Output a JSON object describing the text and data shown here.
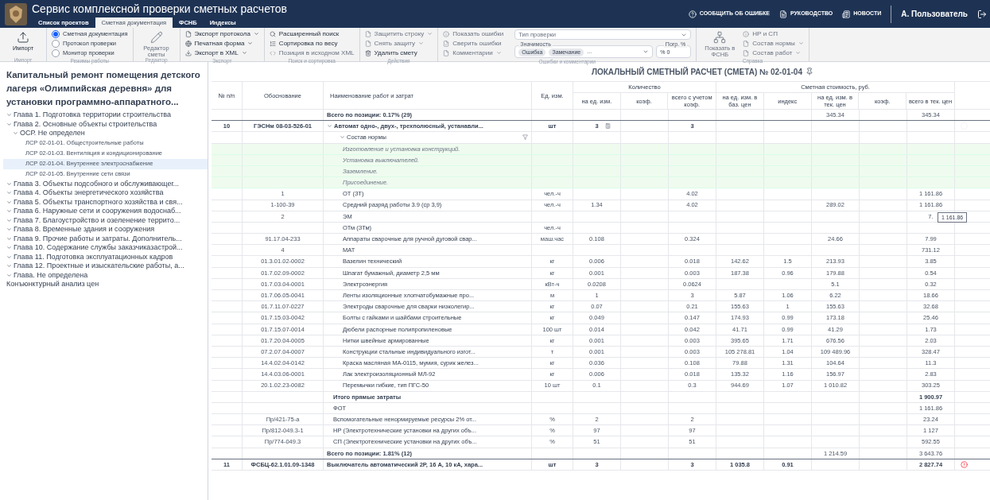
{
  "header": {
    "title": "Сервис комплексной проверки сметных расчетов",
    "tabs": [
      {
        "label": "Список проектов",
        "selected": false
      },
      {
        "label": "Сметная документация",
        "selected": true
      },
      {
        "label": "ФСНБ",
        "selected": false
      },
      {
        "label": "Индексы",
        "selected": false
      }
    ],
    "links": [
      {
        "kind": "help",
        "label": "СООБЩИТЬ ОБ ОШИБКЕ"
      },
      {
        "kind": "doc",
        "label": "РУКОВОДСТВО"
      },
      {
        "kind": "news",
        "label": "НОВОСТИ"
      }
    ],
    "user": "А. Пользователь"
  },
  "ribbon": [
    {
      "label": "Импорт",
      "items": [
        {
          "kind": "large",
          "label": "Импорт",
          "disabled": false
        }
      ]
    },
    {
      "label": "Режимы работы",
      "items": [
        {
          "kind": "radio",
          "label": "Сметная документация",
          "selected": true
        },
        {
          "kind": "radio",
          "label": "Протокол проверки",
          "selected": false
        },
        {
          "kind": "radio",
          "label": "Монитор проверки",
          "selected": false
        }
      ]
    },
    {
      "label": "Редактор",
      "items": [
        {
          "kind": "large",
          "label": "Редактор сметы",
          "disabled": true
        }
      ]
    },
    {
      "label": "Экспорт",
      "items": [
        {
          "kind": "small",
          "label": "Экспорт протокола",
          "dropdown": true,
          "disabled": false
        },
        {
          "kind": "small",
          "label": "Печатная форма",
          "dropdown": true,
          "disabled": false
        },
        {
          "kind": "small",
          "label": "Экспорт в XML",
          "dropdown": true,
          "disabled": false
        }
      ]
    },
    {
      "label": "Поиск и сортировка",
      "items": [
        {
          "kind": "small",
          "label": "Расширенный поиск",
          "dropdown": false,
          "disabled": false
        },
        {
          "kind": "small",
          "label": "Сортировка по весу",
          "dropdown": false,
          "disabled": false
        },
        {
          "kind": "small",
          "label": "Позиция в исходном XML",
          "dropdown": false,
          "disabled": true
        }
      ]
    },
    {
      "label": "Действия",
      "items": [
        {
          "kind": "small",
          "label": "Защитить строку",
          "dropdown": true,
          "disabled": true
        },
        {
          "kind": "small",
          "label": "Снять защиту",
          "dropdown": true,
          "disabled": true
        },
        {
          "kind": "small",
          "label": "Удалить смету",
          "dropdown": false,
          "disabled": false
        }
      ]
    },
    {
      "label": "Ошибки и комментарии",
      "items": [
        {
          "kind": "small",
          "label": "Показать ошибки",
          "dropdown": false,
          "disabled": true
        },
        {
          "kind": "small",
          "label": "Сверить ошибки",
          "dropdown": false,
          "disabled": true
        },
        {
          "kind": "small",
          "label": "Комментарии",
          "dropdown": true,
          "disabled": true
        },
        {
          "kind": "filters",
          "placeholder": "Тип проверки",
          "legend": "Значимость",
          "chips": [
            "Ошибка",
            "Замечание"
          ],
          "more": "...",
          "number_label": "Погр. %",
          "number_value": "% 0"
        }
      ]
    },
    {
      "label": "Справка",
      "items": [
        {
          "kind": "large",
          "label": "Показать в ФСНБ",
          "disabled": true
        },
        {
          "kind": "small",
          "label": "НР и СП",
          "dropdown": false,
          "disabled": true
        },
        {
          "kind": "small",
          "label": "Состав нормы",
          "dropdown": true,
          "disabled": true
        },
        {
          "kind": "small",
          "label": "Состав работ",
          "dropdown": true,
          "disabled": true
        }
      ]
    }
  ],
  "sidebar": {
    "title": "Капитальный ремонт помещения детского лагеря «Олимпийская деревня» для установки программно-аппаратного...",
    "tree": [
      {
        "label": "Глава 1. Подготовка территории строительства",
        "expanded": true,
        "selected": false
      },
      {
        "label": "Глава 2. Основные объекты строительства",
        "expanded": true,
        "selected": false,
        "children": [
          {
            "label": "ОСР. Не определен",
            "expanded": true,
            "selected": false,
            "children": [
              {
                "label": "ЛСР 02-01-01. Общестроительные работы",
                "selected": false
              },
              {
                "label": "ЛСР 02-01-03. Вентиляция и кондиционирование",
                "selected": false
              },
              {
                "label": "ЛСР 02-01-04. Внутреннее электроснабжение",
                "selected": true
              },
              {
                "label": "ЛСР 02-01-05. Внутренние сети связи",
                "selected": false
              }
            ]
          }
        ]
      },
      {
        "label": "Глава 3. Объекты подсобного и обслуживающег...",
        "expanded": true,
        "selected": false
      },
      {
        "label": "Глава 4. Объекты энергетического хозяйства",
        "expanded": true,
        "selected": false
      },
      {
        "label": "Глава 5. Объекты транспортного хозяйства и свя...",
        "expanded": true,
        "selected": false
      },
      {
        "label": "Глава 6. Наружные сети и сооружения водоснаб...",
        "expanded": true,
        "selected": false
      },
      {
        "label": "Глава 7. Благоустройство и озеленение террито...",
        "expanded": true,
        "selected": false
      },
      {
        "label": "Глава 8. Временные здания и сооружения",
        "expanded": true,
        "selected": false
      },
      {
        "label": "Глава 9. Прочие работы и затраты. Дополнитель...",
        "expanded": true,
        "selected": false
      },
      {
        "label": "Глава 10. Содержание службы заказчиказастрой...",
        "expanded": true,
        "selected": false
      },
      {
        "label": "Глава 11. Подготовка эксплуатационных кадров",
        "expanded": true,
        "selected": false
      },
      {
        "label": "Глава 12. Проектные и изыскательские работы, а...",
        "expanded": true,
        "selected": false
      },
      {
        "label": "Глава. Не определена",
        "expanded": true,
        "selected": false
      },
      {
        "label": "Конъюнктурный анализ цен",
        "selected": false
      }
    ]
  },
  "estimate": {
    "title": "ЛОКАЛЬНЫЙ СМЕТНЫЙ РАСЧЕТ (СМЕТА) № 02-01-04",
    "columns": {
      "number": "№ п/п",
      "code": "Обоснование",
      "name": "Наименование работ и затрат",
      "unit": "Ед. изм.",
      "quantity": "Количество",
      "per_unit": "на ед. изм.",
      "coef": "коэф.",
      "total_qty": "всего с учетом коэф.",
      "cost": "Сметная стоимость, руб.",
      "base_price": "на ед. изм. в баз. цен",
      "index": "индекс",
      "current_price": "на ед. изм. в тек. цен",
      "coef2": "коэф.",
      "total_current": "всего в тек. цен"
    },
    "tooltip": "1 161.86",
    "rows": [
      {
        "kind": "total",
        "name": "Всего по позиции: 0.17% (29)",
        "current_price": "345.34",
        "total_current": "345.34"
      },
      {
        "kind": "position",
        "number": "10",
        "code": "ГЭСНм 08-03-526-01",
        "name": "Автомат одно-, двух-, трехполюсный, устанавли...",
        "unit": "шт",
        "per_unit": "3",
        "total_qty": "3",
        "expanded": true,
        "error": false
      },
      {
        "kind": "group",
        "name": "Состав нормы",
        "expanded": true
      },
      {
        "kind": "work",
        "name": "Изготовление и установка конструкций."
      },
      {
        "kind": "work",
        "name": "Установка выключателей."
      },
      {
        "kind": "work",
        "name": "Заземление."
      },
      {
        "kind": "work",
        "name": "Присоединение."
      },
      {
        "kind": "resource",
        "code": "1",
        "name": "ОТ (ЗТ)",
        "unit": "чел.-ч",
        "total_qty": "4.02",
        "total_current": "1 161.86"
      },
      {
        "kind": "resource",
        "code": "1-100-39",
        "name": "Средний разряд работы 3.9 (ср 3,9)",
        "unit": "чел.-ч",
        "per_unit": "1.34",
        "total_qty": "4.02",
        "current_price": "289.02",
        "total_current": "1 161.86"
      },
      {
        "kind": "resource",
        "code": "2",
        "name": "ЭМ",
        "total_current": "7.",
        "tooltip": true
      },
      {
        "kind": "resource",
        "name": "ОТм (ЗТм)",
        "unit": "чел.-ч"
      },
      {
        "kind": "resource",
        "code": "91.17.04-233",
        "name": "Аппараты сварочные для ручной дуговой свар...",
        "unit": "маш.час",
        "per_unit": "0.108",
        "total_qty": "0.324",
        "current_price": "24.66",
        "total_current": "7.99"
      },
      {
        "kind": "resource",
        "code": "4",
        "name": "МАТ",
        "total_current": "731.12"
      },
      {
        "kind": "resource",
        "code": "01.3.01.02-0002",
        "name": "Вазелин технический",
        "unit": "кг",
        "per_unit": "0.006",
        "total_qty": "0.018",
        "base_price": "142.62",
        "index": "1.5",
        "current_price": "213.93",
        "total_current": "3.85"
      },
      {
        "kind": "resource",
        "code": "01.7.02.09-0002",
        "name": "Шпагат бумажный, диаметр 2,5 мм",
        "unit": "кг",
        "per_unit": "0.001",
        "total_qty": "0.003",
        "base_price": "187.38",
        "index": "0.96",
        "current_price": "179.88",
        "total_current": "0.54"
      },
      {
        "kind": "resource",
        "code": "01.7.03.04-0001",
        "name": "Электроэнергия",
        "unit": "кВт-ч",
        "per_unit": "0.0208",
        "total_qty": "0.0624",
        "current_price": "5.1",
        "total_current": "0.32"
      },
      {
        "kind": "resource",
        "code": "01.7.06.05-0041",
        "name": "Ленты изоляционные хлопчатобумажные про...",
        "unit": "м",
        "per_unit": "1",
        "total_qty": "3",
        "base_price": "5.87",
        "index": "1.06",
        "current_price": "6.22",
        "total_current": "18.66"
      },
      {
        "kind": "resource",
        "code": "01.7.11.07-0227",
        "name": "Электроды сварочные для сварки низколегир...",
        "unit": "кг",
        "per_unit": "0.07",
        "total_qty": "0.21",
        "base_price": "155.63",
        "index": "1",
        "current_price": "155.63",
        "total_current": "32.68"
      },
      {
        "kind": "resource",
        "code": "01.7.15.03-0042",
        "name": "Болты с гайками и шайбами строительные",
        "unit": "кг",
        "per_unit": "0.049",
        "total_qty": "0.147",
        "base_price": "174.93",
        "index": "0.99",
        "current_price": "173.18",
        "total_current": "25.46"
      },
      {
        "kind": "resource",
        "code": "01.7.15.07-0014",
        "name": "Дюбели распорные полипропиленовые",
        "unit": "100 шт",
        "per_unit": "0.014",
        "total_qty": "0.042",
        "base_price": "41.71",
        "index": "0.99",
        "current_price": "41.29",
        "total_current": "1.73"
      },
      {
        "kind": "resource",
        "code": "01.7.20.04-0005",
        "name": "Нитки швейные армированные",
        "unit": "кг",
        "per_unit": "0.001",
        "total_qty": "0.003",
        "base_price": "395.65",
        "index": "1.71",
        "current_price": "676.56",
        "total_current": "2.03"
      },
      {
        "kind": "resource",
        "code": "07.2.07.04-0007",
        "name": "Конструкции стальные индивидуального изгот...",
        "unit": "т",
        "per_unit": "0.001",
        "total_qty": "0.003",
        "base_price": "105 278.81",
        "index": "1.04",
        "current_price": "109 489.96",
        "total_current": "328.47"
      },
      {
        "kind": "resource",
        "code": "14.4.02.04-0142",
        "name": "Краска масляная МА-0115, мумия, сурик желез...",
        "unit": "кг",
        "per_unit": "0.036",
        "total_qty": "0.108",
        "base_price": "79.88",
        "index": "1.31",
        "current_price": "104.64",
        "total_current": "11.3"
      },
      {
        "kind": "resource",
        "code": "14.4.03.06-0001",
        "name": "Лак электроизоляционный МЛ-92",
        "unit": "кг",
        "per_unit": "0.006",
        "total_qty": "0.018",
        "base_price": "135.32",
        "index": "1.16",
        "current_price": "156.97",
        "total_current": "2.83"
      },
      {
        "kind": "resource",
        "code": "20.1.02.23-0082",
        "name": "Перемычки гибкие, тип ПГС-50",
        "unit": "10 шт",
        "per_unit": "0.1",
        "total_qty": "0.3",
        "base_price": "944.69",
        "index": "1.07",
        "current_price": "1 010.82",
        "total_current": "303.25"
      },
      {
        "kind": "subtotal",
        "name": "Итого прямые затраты",
        "total_current": "1 900.97"
      },
      {
        "kind": "overhead",
        "name": "ФОТ",
        "total_current": "1 161.86"
      },
      {
        "kind": "overhead",
        "code": "Пр/421-75-а",
        "name": "Вспомогательные ненормируемые ресурсы 2% от...",
        "unit": "%",
        "per_unit": "2",
        "total_qty": "2",
        "total_current": "23.24"
      },
      {
        "kind": "overhead",
        "code": "Пр/812-049.3-1",
        "name": "НР (Электротехнические установки на других объ...",
        "unit": "%",
        "per_unit": "97",
        "total_qty": "97",
        "total_current": "1 127"
      },
      {
        "kind": "overhead",
        "code": "Пр/774-049.3",
        "name": "СП (Электротехнические установки на других объ...",
        "unit": "%",
        "per_unit": "51",
        "total_qty": "51",
        "total_current": "592.55"
      },
      {
        "kind": "total",
        "name": "Всего по позиции: 1.81% (12)",
        "current_price": "1 214.59",
        "total_current": "3 643.76"
      },
      {
        "kind": "position",
        "number": "11",
        "code": "ФСБЦ-62.1.01.09-1348",
        "name": "Выключатель автоматический 2Р, 16 А, 10 кА, хара...",
        "unit": "шт",
        "per_unit": "3",
        "total_qty": "3",
        "base_price": "1 035.8",
        "index": "0.91",
        "total_current": "2 827.74",
        "error": true
      }
    ]
  }
}
